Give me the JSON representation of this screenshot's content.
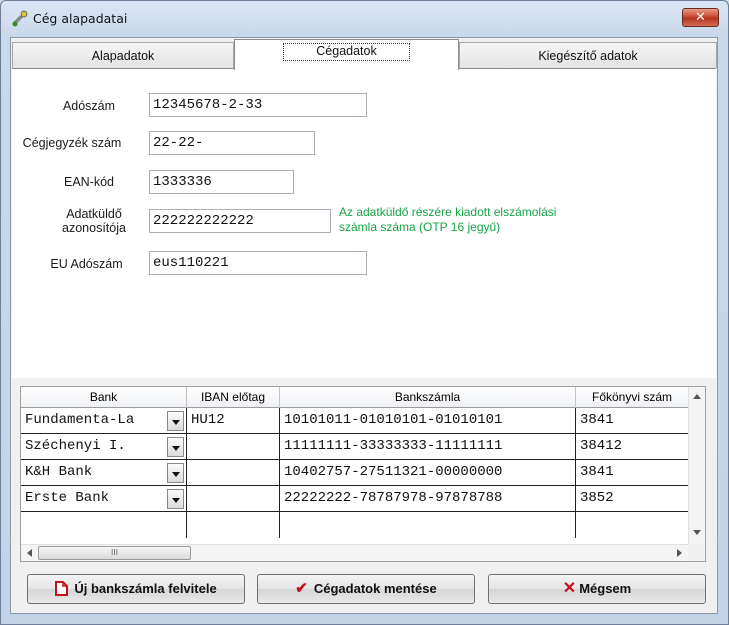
{
  "window": {
    "title": "Cég alapadatai",
    "close_label": "✕"
  },
  "tabs": [
    {
      "label": "Alapadatok"
    },
    {
      "label": "Cégadatok",
      "active": true
    },
    {
      "label": "Kiegészítő adatok"
    }
  ],
  "form": {
    "adoszam": {
      "label": "Adószám",
      "value": "12345678-2-33"
    },
    "cegjegyzek": {
      "label": "Cégjegyzék szám",
      "value": "22-22-"
    },
    "ean": {
      "label": "EAN-kód",
      "value": "1333336"
    },
    "adatkuldo": {
      "label_line1": "Adatküldő",
      "label_line2": "azonosítója",
      "value": "222222222222"
    },
    "adatkuldo_hint": {
      "line1": "Az adatküldő részére kiadott  elszámolási",
      "line2": "számla száma (OTP 16 jegyű)"
    },
    "eu_adoszam": {
      "label": "EU Adószám",
      "value": "eus110221"
    }
  },
  "grid": {
    "columns": [
      "Bank",
      "IBAN előtag",
      "Bankszámla",
      "Főkönyvi szám"
    ],
    "rows": [
      {
        "bank": "Fundamenta-La",
        "iban": "HU12",
        "account": "10101011-01010101-01010101",
        "ledger": "3841"
      },
      {
        "bank": "Széchenyi I.",
        "iban": "",
        "account": "11111111-33333333-11111111",
        "ledger": "38412"
      },
      {
        "bank": "K&H Bank",
        "iban": "",
        "account": "10402757-27511321-00000000",
        "ledger": "3841"
      },
      {
        "bank": "Erste Bank",
        "iban": "",
        "account": "22222222-78787978-97878788",
        "ledger": "3852"
      }
    ],
    "hscroll_thumb": "III"
  },
  "buttons": {
    "new_account": "Új bankszámla felvitele",
    "save": "Cégadatok mentése",
    "cancel": "Mégsem"
  },
  "colors": {
    "hint": "#16a344",
    "cancel_icon": "#c0141c",
    "save_icon": "#c0141c"
  }
}
